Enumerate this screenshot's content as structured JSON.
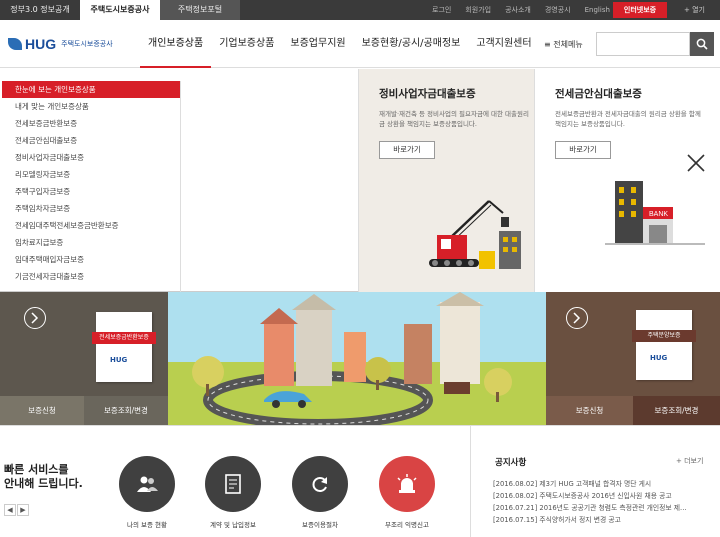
{
  "topbar": {
    "tabs": [
      "정부3.0 정보공개",
      "주택도시보증공사",
      "주택정보포털"
    ],
    "links": [
      "로그인",
      "회원가입",
      "공사소개",
      "경영공시",
      "English"
    ],
    "cta": "인터넷보증",
    "more": "+ 열기"
  },
  "header": {
    "logo_text": "HUG",
    "logo_sub": "주택도시보증공사",
    "nav": [
      "개인보증상품",
      "기업보증상품",
      "보증업무지원",
      "보증현황/공시/공매정보",
      "고객지원센터"
    ],
    "all_menu": "≡ 전체메뉴",
    "search_placeholder": ""
  },
  "dropdown": {
    "items": [
      "한눈에 보는 개인보증상품",
      "내게 맞는 개인보증상품",
      "전세보증금반환보증",
      "전세금안심대출보증",
      "정비사업자금대출보증",
      "리모델링자금보증",
      "주택구입자금보증",
      "주택임차자금보증",
      "전세임대주택전세보증금반환보증",
      "임차료지급보증",
      "임대주택매입자금보증",
      "기금전세자금대출보증"
    ],
    "cards": [
      {
        "title": "정비사업자금대출보증",
        "desc": "재개발·재건축 등 정비사업의 필요자금에 대한 대출원리금 상환을 책임지는 보증상품입니다.",
        "button": "바로가기"
      },
      {
        "title": "전세금안심대출보증",
        "desc": "전세보증금반환과 전세자금대출의 원리금 상환을 함께 책임지는 보증상품입니다.",
        "button": "바로가기"
      }
    ]
  },
  "hero": {
    "left": {
      "book_label": "전세보증금반환보증",
      "buttons": [
        "보증신청",
        "보증조회/변경"
      ]
    },
    "right": {
      "book_label": "주택분양보증",
      "buttons": [
        "보증신청",
        "보증조회/변경"
      ]
    },
    "bank_sign": "BANK"
  },
  "quick": {
    "title_line1": "빠른 서비스를",
    "title_line2": "안내해 드립니다.",
    "pager": [
      "◀",
      "▶"
    ],
    "items": [
      {
        "label": "나의 보증 현황",
        "icon": "users-icon"
      },
      {
        "label": "계약 및 납입정보",
        "icon": "contract-icon"
      },
      {
        "label": "보증이용절차",
        "icon": "refresh-icon"
      },
      {
        "label": "부조리 익명신고",
        "icon": "siren-icon"
      }
    ]
  },
  "notice": {
    "title": "공지사항",
    "more": "+ 더보기",
    "items": [
      "[2016.08.02] 제3기 HUG 고객패널 합격자 명단 게시",
      "[2016.08.02] 주택도시보증공사 2016년 신입사원 채용 공고",
      "[2016.07.21] 2016년도 공공기관 청렴도 측정관련 개인정보 제...",
      "[2016.07.15] 주식양허가서 정지 변경 공고"
    ]
  },
  "colors": {
    "accent": "#d71f28",
    "brand": "#1b4e9b"
  }
}
